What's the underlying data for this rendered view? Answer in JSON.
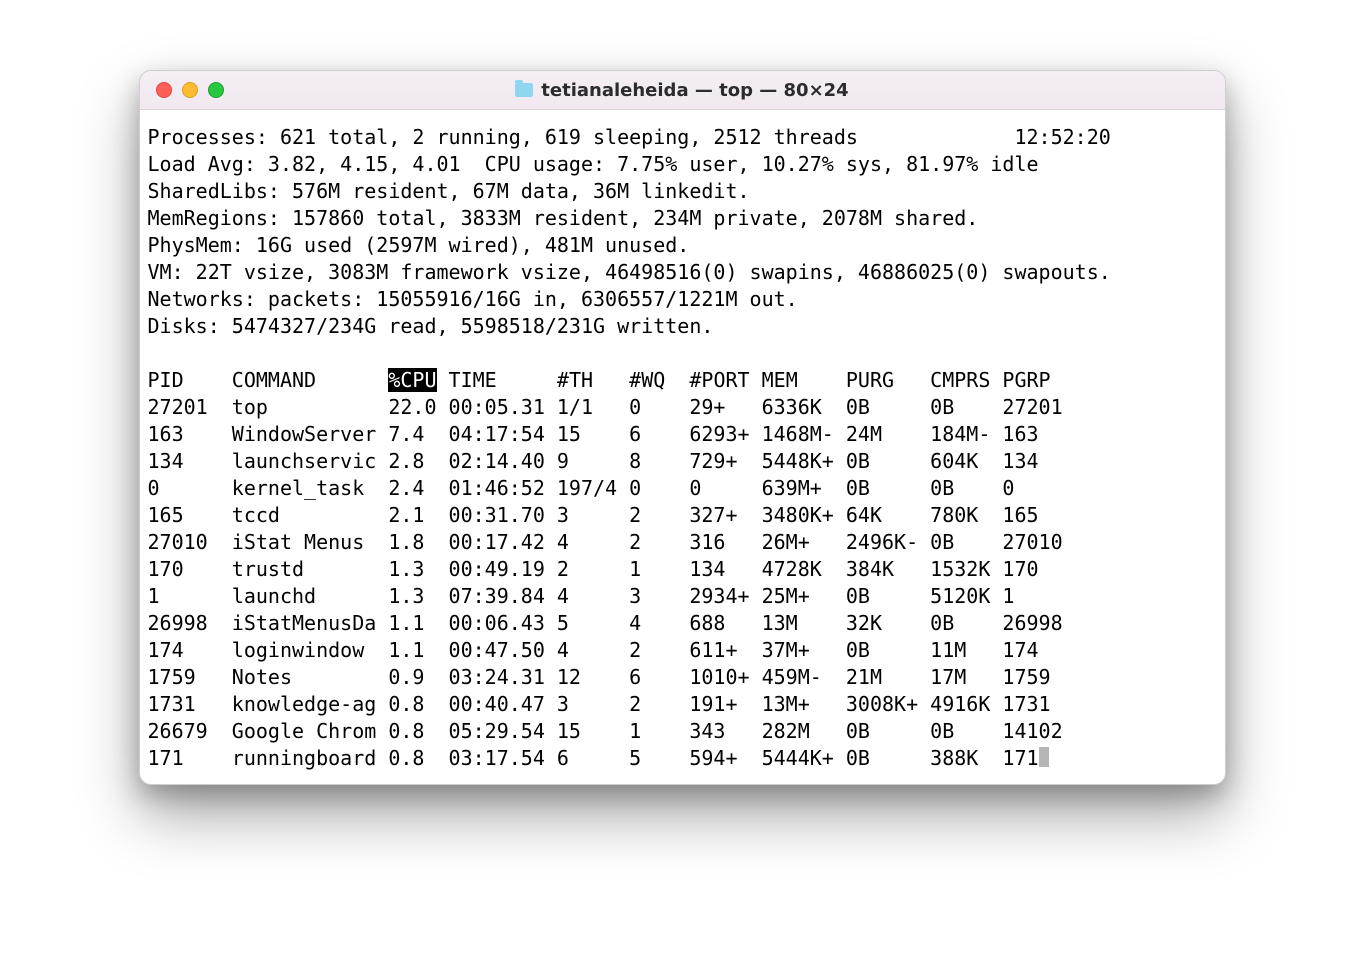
{
  "window": {
    "title": "tetianaleheida — top — 80×24"
  },
  "header": {
    "processes": "Processes: 621 total, 2 running, 619 sleeping, 2512 threads",
    "time": "12:52:20",
    "loadavg": "Load Avg: 3.82, 4.15, 4.01  CPU usage: 7.75% user, 10.27% sys, 81.97% idle",
    "sharedlibs": "SharedLibs: 576M resident, 67M data, 36M linkedit.",
    "memregions": "MemRegions: 157860 total, 3833M resident, 234M private, 2078M shared.",
    "physmem": "PhysMem: 16G used (2597M wired), 481M unused.",
    "vm": "VM: 22T vsize, 3083M framework vsize, 46498516(0) swapins, 46886025(0) swapouts.",
    "networks": "Networks: packets: 15055916/16G in, 6306557/1221M out.",
    "disks": "Disks: 5474327/234G read, 5598518/231G written."
  },
  "columns": {
    "pid": "PID",
    "command": "COMMAND",
    "cpu": "%CPU",
    "time": "TIME",
    "th": "#TH",
    "wq": "#WQ",
    "port": "#PORT",
    "mem": "MEM",
    "purg": "PURG",
    "cmprs": "CMPRS",
    "pgrp": "PGRP"
  },
  "rows": [
    {
      "pid": "27201",
      "command": "top",
      "cpu": "22.0",
      "time": "00:05.31",
      "th": "1/1",
      "wq": "0",
      "port": "29+",
      "mem": "6336K",
      "purg": "0B",
      "cmprs": "0B",
      "pgrp": "27201"
    },
    {
      "pid": "163",
      "command": "WindowServer",
      "cpu": "7.4",
      "time": "04:17:54",
      "th": "15",
      "wq": "6",
      "port": "6293+",
      "mem": "1468M-",
      "purg": "24M",
      "cmprs": "184M-",
      "pgrp": "163"
    },
    {
      "pid": "134",
      "command": "launchservic",
      "cpu": "2.8",
      "time": "02:14.40",
      "th": "9",
      "wq": "8",
      "port": "729+",
      "mem": "5448K+",
      "purg": "0B",
      "cmprs": "604K",
      "pgrp": "134"
    },
    {
      "pid": "0",
      "command": "kernel_task",
      "cpu": "2.4",
      "time": "01:46:52",
      "th": "197/4",
      "wq": "0",
      "port": "0",
      "mem": "639M+",
      "purg": "0B",
      "cmprs": "0B",
      "pgrp": "0"
    },
    {
      "pid": "165",
      "command": "tccd",
      "cpu": "2.1",
      "time": "00:31.70",
      "th": "3",
      "wq": "2",
      "port": "327+",
      "mem": "3480K+",
      "purg": "64K",
      "cmprs": "780K",
      "pgrp": "165"
    },
    {
      "pid": "27010",
      "command": "iStat Menus",
      "cpu": "1.8",
      "time": "00:17.42",
      "th": "4",
      "wq": "2",
      "port": "316",
      "mem": "26M+",
      "purg": "2496K-",
      "cmprs": "0B",
      "pgrp": "27010"
    },
    {
      "pid": "170",
      "command": "trustd",
      "cpu": "1.3",
      "time": "00:49.19",
      "th": "2",
      "wq": "1",
      "port": "134",
      "mem": "4728K",
      "purg": "384K",
      "cmprs": "1532K",
      "pgrp": "170"
    },
    {
      "pid": "1",
      "command": "launchd",
      "cpu": "1.3",
      "time": "07:39.84",
      "th": "4",
      "wq": "3",
      "port": "2934+",
      "mem": "25M+",
      "purg": "0B",
      "cmprs": "5120K",
      "pgrp": "1"
    },
    {
      "pid": "26998",
      "command": "iStatMenusDa",
      "cpu": "1.1",
      "time": "00:06.43",
      "th": "5",
      "wq": "4",
      "port": "688",
      "mem": "13M",
      "purg": "32K",
      "cmprs": "0B",
      "pgrp": "26998"
    },
    {
      "pid": "174",
      "command": "loginwindow",
      "cpu": "1.1",
      "time": "00:47.50",
      "th": "4",
      "wq": "2",
      "port": "611+",
      "mem": "37M+",
      "purg": "0B",
      "cmprs": "11M",
      "pgrp": "174"
    },
    {
      "pid": "1759",
      "command": "Notes",
      "cpu": "0.9",
      "time": "03:24.31",
      "th": "12",
      "wq": "6",
      "port": "1010+",
      "mem": "459M-",
      "purg": "21M",
      "cmprs": "17M",
      "pgrp": "1759"
    },
    {
      "pid": "1731",
      "command": "knowledge-ag",
      "cpu": "0.8",
      "time": "00:40.47",
      "th": "3",
      "wq": "2",
      "port": "191+",
      "mem": "13M+",
      "purg": "3008K+",
      "cmprs": "4916K",
      "pgrp": "1731"
    },
    {
      "pid": "26679",
      "command": "Google Chrom",
      "cpu": "0.8",
      "time": "05:29.54",
      "th": "15",
      "wq": "1",
      "port": "343",
      "mem": "282M",
      "purg": "0B",
      "cmprs": "0B",
      "pgrp": "14102"
    },
    {
      "pid": "171",
      "command": "runningboard",
      "cpu": "0.8",
      "time": "03:17.54",
      "th": "6",
      "wq": "5",
      "port": "594+",
      "mem": "5444K+",
      "purg": "0B",
      "cmprs": "388K",
      "pgrp": "171"
    }
  ]
}
